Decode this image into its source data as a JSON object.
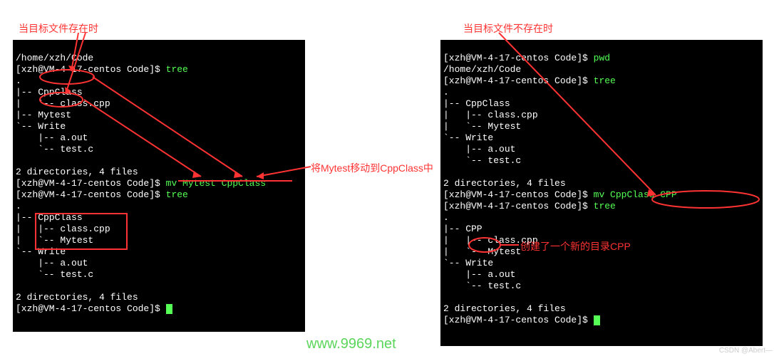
{
  "annotations": {
    "title_left": "当目标文件存在时",
    "title_right": "当目标文件不存在时",
    "move_note": "将Mytest移动到CppClass中",
    "create_note": "创建了一个新的目录CPP"
  },
  "left": {
    "l1": "/home/xzh/Code",
    "l2a": "[xzh@VM-4-17-centos Code]$",
    "l2b": " tree",
    "l3": ".",
    "l4": "|-- CppClass",
    "l5": "|   `-- class.cpp",
    "l6": "|-- Mytest",
    "l7": "`-- Write",
    "l8": "    |-- a.out",
    "l9": "    `-- test.c",
    "l10": "",
    "l11": "2 directories, 4 files",
    "l12a": "[xzh@VM-4-17-centos Code]$",
    "l12b": " mv Mytest CppClass",
    "l13a": "[xzh@VM-4-17-centos Code]$",
    "l13b": " tree",
    "l14": ".",
    "l15": "|-- CppClass",
    "l16": "|   |-- class.cpp",
    "l17": "|   `-- Mytest",
    "l18": "`-- Write",
    "l19": "    |-- a.out",
    "l20": "    `-- test.c",
    "l21": "",
    "l22": "2 directories, 4 files",
    "l23a": "[xzh@VM-4-17-centos Code]$",
    "l23b": " "
  },
  "right": {
    "l1a": "[xzh@VM-4-17-centos Code]$",
    "l1b": " pwd",
    "l2": "/home/xzh/Code",
    "l3a": "[xzh@VM-4-17-centos Code]$",
    "l3b": " tree",
    "l4": ".",
    "l5": "|-- CppClass",
    "l6": "|   |-- class.cpp",
    "l7": "|   `-- Mytest",
    "l8": "`-- Write",
    "l9": "    |-- a.out",
    "l10": "    `-- test.c",
    "l11": "",
    "l12": "2 directories, 4 files",
    "l13a": "[xzh@VM-4-17-centos Code]$",
    "l13b": " mv CppClass CPP",
    "l14a": "[xzh@VM-4-17-centos Code]$",
    "l14b": " tree",
    "l15": ".",
    "l16": "|-- CPP",
    "l17": "|   |-- class.cpp",
    "l18": "|   `-- Mytest",
    "l19": "`-- Write",
    "l20": "    |-- a.out",
    "l21": "    `-- test.c",
    "l22": "",
    "l23": "2 directories, 4 files",
    "l24a": "[xzh@VM-4-17-centos Code]$",
    "l24b": " "
  },
  "watermark": "www.9969.net",
  "credit": "CSDN @Abert—"
}
